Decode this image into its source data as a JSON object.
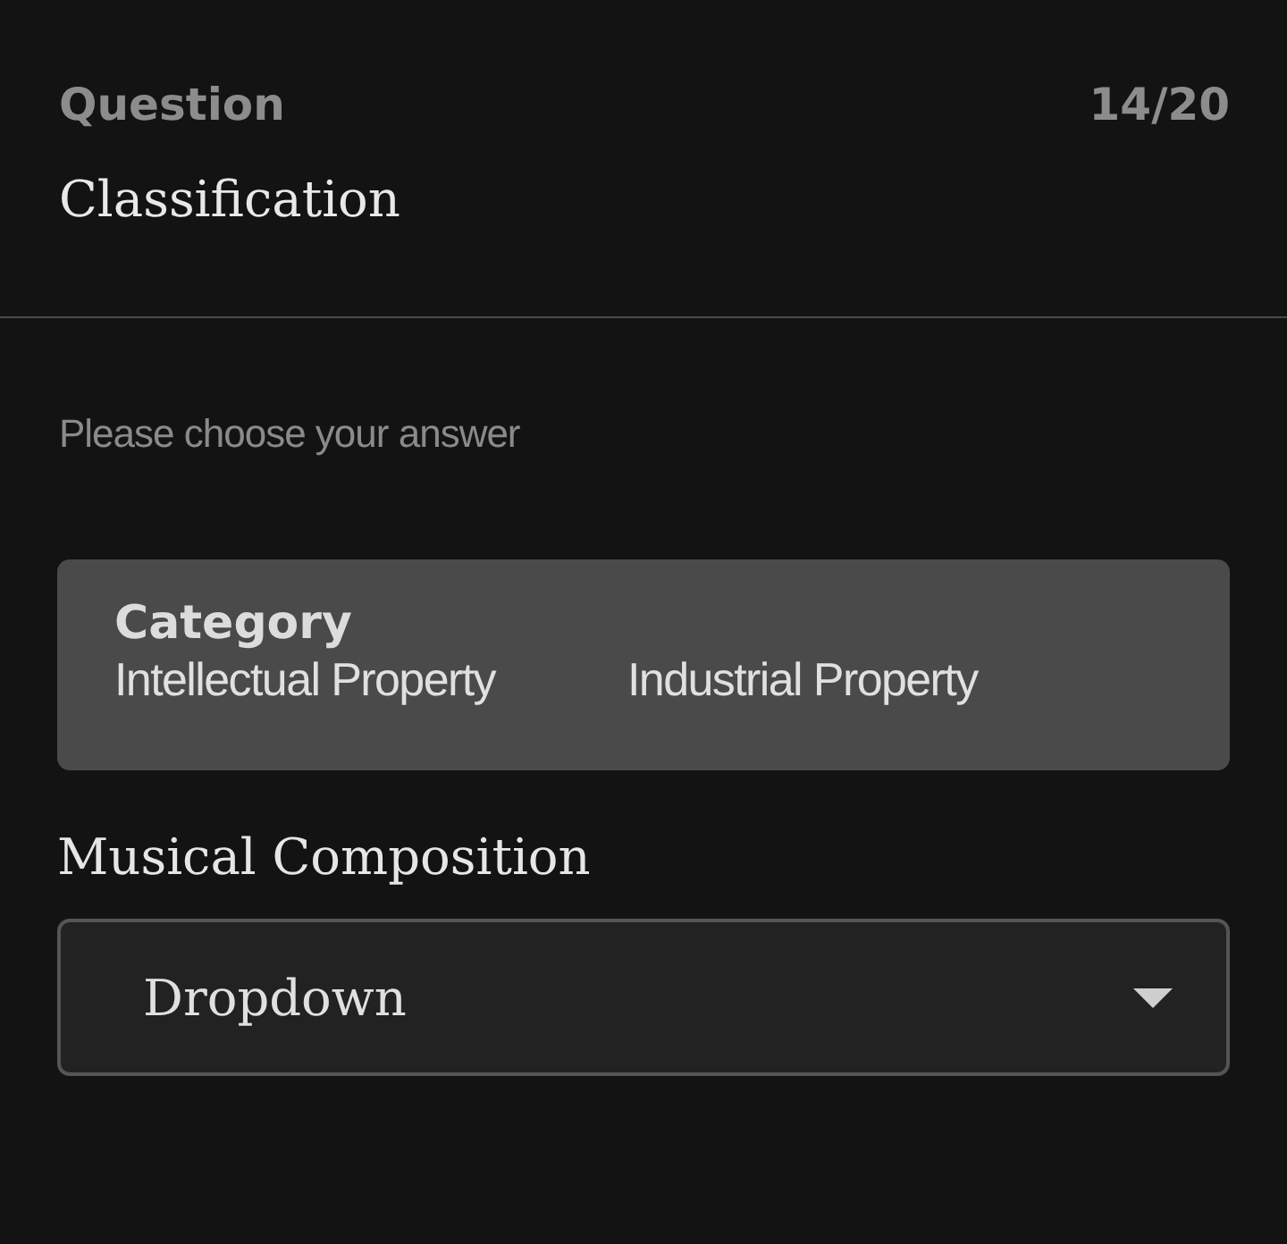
{
  "header": {
    "label": "Question",
    "progress": "14/20"
  },
  "question": {
    "title": "Classification"
  },
  "instruction": "Please choose your answer",
  "category": {
    "title": "Category",
    "options": [
      "Intellectual Property",
      "Industrial Property"
    ]
  },
  "item": {
    "label": "Musical Composition",
    "dropdown": {
      "value": "Dropdown"
    }
  }
}
